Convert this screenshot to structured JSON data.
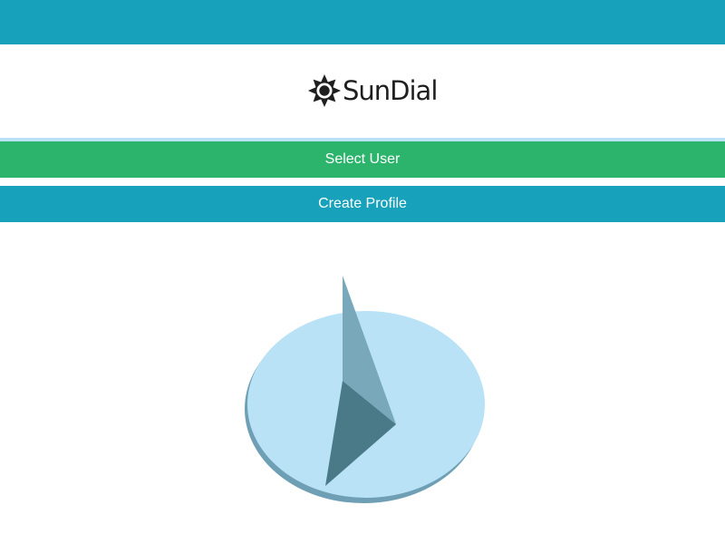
{
  "app": {
    "name": "SunDial",
    "icon": "sun-icon"
  },
  "colors": {
    "header_bar": "#17a1ba",
    "select_user_button": "#2db46c",
    "create_profile_button": "#17a1ba",
    "separator": "#b9e2f6",
    "dial_face": "#b9e2f6",
    "dial_edge": "#6f9fb5"
  },
  "actions": {
    "select_user_label": "Select User",
    "create_profile_label": "Create Profile"
  },
  "illustration": {
    "icon": "sundial-icon"
  }
}
